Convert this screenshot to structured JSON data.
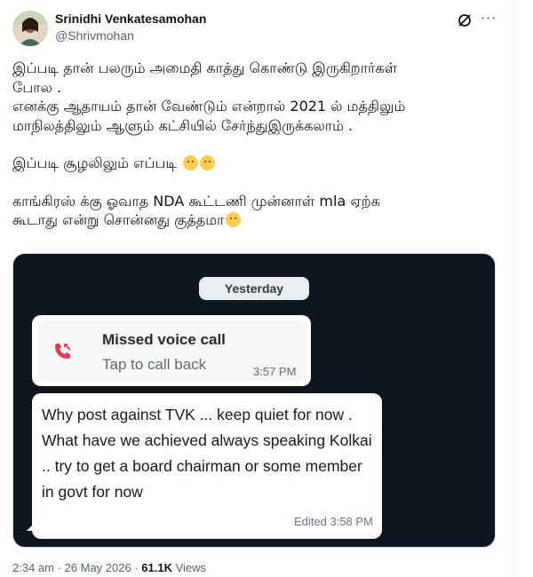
{
  "author": {
    "display_name": "Srinidhi Venkatesamohan",
    "handle": "@Shrivmohan",
    "avatar_icon": "profile-avatar"
  },
  "header_actions": {
    "grok_icon": "grok-icon",
    "more_icon": "more-options-icon"
  },
  "tweet": {
    "line1": "இப்படி தான் பலரும் அமைதி காத்து கொண்டு இருகிறார்கள்",
    "line2": "போல .",
    "line3": "எனக்கு ஆதாயம் தான் வேண்டும் என்றால் 2021 ல் மத்திலும்",
    "line4": "மாநிலத்திலும் ஆளும் கட்சியில் சேர்ந்துஇருக்கலாம் .",
    "line5": "இப்படி சூழலிலும் எப்படி",
    "line6": "காங்கிரஸ் க்கு ஓவாத NDA கூட்டணி முன்னாள் mla ஏற்க",
    "line7": "கூடாது என்று சொன்னது குத்தமா",
    "emoji_colors": {
      "face": "#ffcc4d"
    }
  },
  "screenshot": {
    "date_pill": "Yesterday",
    "call": {
      "title": "Missed voice call",
      "subtitle": "Tap to call back",
      "time": "3:57 PM",
      "icon": "missed-call-icon",
      "icon_color": "#e8384f"
    },
    "message": {
      "text": "Why post against TVK ... keep quiet for now . What have we achieved always speaking Kolkai .. try to get a board chairman or some member in govt for now",
      "meta": "Edited 3:58 PM"
    },
    "background_color": "#10161f"
  },
  "footer": {
    "time": "2:34 am",
    "separator": " · ",
    "date": "26 May 2026",
    "views_count": "61.1K",
    "views_label": " Views"
  }
}
